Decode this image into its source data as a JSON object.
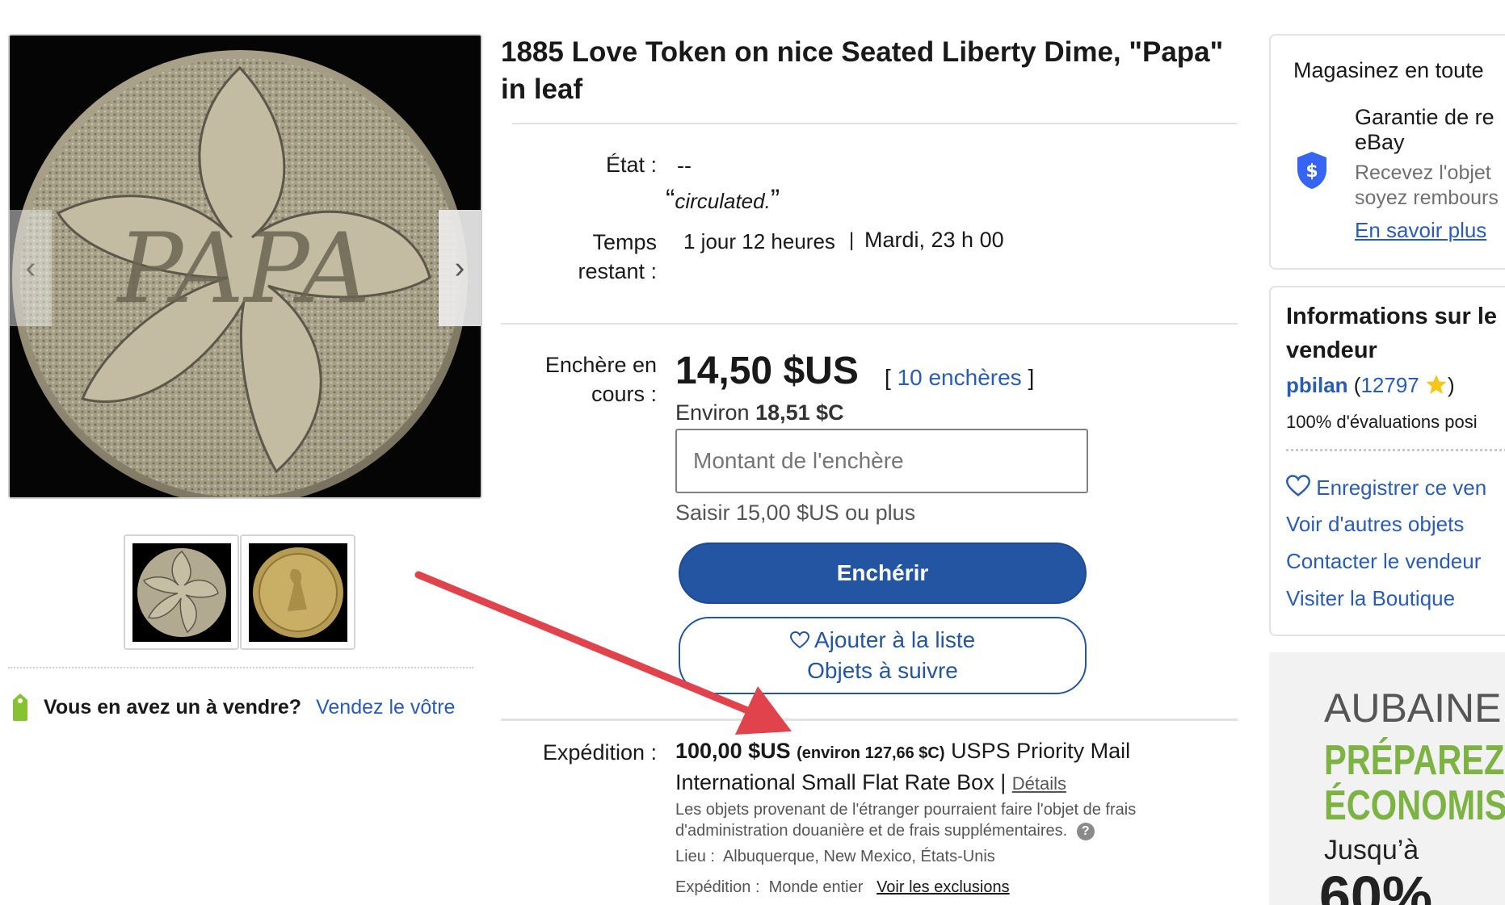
{
  "gallery": {
    "main_image_alt": "1885 Love Token coin engraved PAPA",
    "coin_engraving": "PAPA",
    "prev_label": "‹",
    "next_label": "›"
  },
  "sell_prompt": {
    "question": "Vous en avez un à vendre?",
    "link": "Vendez le vôtre"
  },
  "listing": {
    "title": "1885 Love Token on nice Seated Liberty Dime, \"Papa\" in leaf",
    "condition_label": "État :",
    "condition_value": "--",
    "condition_quote_open": "“",
    "condition_quote": "circulated.",
    "condition_quote_close": "”",
    "time_label_1": "Temps",
    "time_label_2": "restant :",
    "time_value": "1 jour 12  heures",
    "time_sep": "|",
    "time_end": "Mardi, 23 h 00",
    "bid_label_1": "Enchère en",
    "bid_label_2": "cours :",
    "current_price": "14,50 $US",
    "bids_open": "[",
    "bids_count": "10 enchères",
    "bids_close": "]",
    "approx_prefix": "Environ",
    "approx_value": "18,51 $C",
    "bid_placeholder": "Montant de l'enchère",
    "bid_hint": "Saisir 15,00 $US ou plus",
    "bid_button": "Enchérir",
    "watch_line_1": "Ajouter à la liste",
    "watch_line_2": "Objets à suivre",
    "shipping_label": "Expédition :",
    "shipping_cost": "100,00 $US",
    "shipping_approx": "(environ 127,66 $C)",
    "shipping_service_1": "USPS Priority Mail",
    "shipping_service_2": "International Small Flat Rate Box |",
    "shipping_details": "Détails",
    "customs_note_1": "Les objets provenant de l'étranger pourraient faire l'objet de frais",
    "customs_note_2": "d'administration douanière et de frais supplémentaires.",
    "help_icon": "?",
    "location_label": "Lieu :",
    "location_value": "Albuquerque, New Mexico, États-Unis",
    "ship_to_label": "Expédition :",
    "ship_to_value": "Monde entier",
    "exclusions_link": "Voir les exclusions"
  },
  "guarantee_card": {
    "heading": "Magasinez en toute",
    "title_1": "Garantie de re",
    "title_2": "eBay",
    "desc_1": "Recevez l'objet",
    "desc_2": "soyez rembours",
    "link": "En savoir plus"
  },
  "seller_card": {
    "heading_1": "Informations sur le",
    "heading_2": "vendeur",
    "seller_name": "pbilan",
    "feedback_open": "(",
    "feedback_score": "12797",
    "feedback_close": ")",
    "positive": "100% d'évaluations posi",
    "save_seller": "Enregistrer ce ven",
    "other_items": "Voir d'autres objets",
    "contact": "Contacter le vendeur",
    "store": "Visiter la Boutique"
  },
  "ad": {
    "line1": "AUBAINE",
    "line2": "PRÉPAREZ-",
    "line3": "ÉCONOMIS",
    "line4": "Jusqu’à",
    "line5": "60%"
  },
  "colors": {
    "link_blue": "#2a5cb5",
    "button_blue": "#2355a3",
    "arrow_red": "#e0434b",
    "ad_green": "#7cb342"
  }
}
